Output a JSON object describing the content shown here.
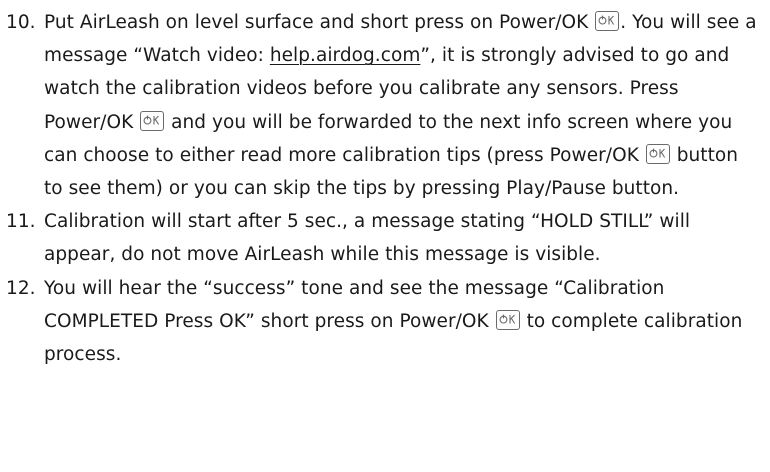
{
  "steps": [
    {
      "number": "10.",
      "parts": [
        "Put AirLeash on level surface and short press on Power/OK ",
        ". You will see a message “Watch video: ",
        "help.airdog.com",
        "”, it is strongly advised to go and watch the calibration videos before you calibrate any sensors. Press Power/OK ",
        " and you will be forwarded to the next info screen where you can choose to either read more calibration tips (press Power/OK ",
        " button to see them) or you can skip the tips by pressing Play/Pause button."
      ]
    },
    {
      "number": "11.",
      "parts": [
        "Calibration will start after 5 sec., a message stating “HOLD STILL” will appear, do not move AirLeash while this message is visible."
      ]
    },
    {
      "number": "12.",
      "parts": [
        "You will hear the “success” tone and see the message “Calibration COMPLETED Press OK” short press on Power/OK ",
        " to complete calibration process."
      ]
    }
  ],
  "icons": {
    "ok_key": "power-ok-key-icon"
  }
}
